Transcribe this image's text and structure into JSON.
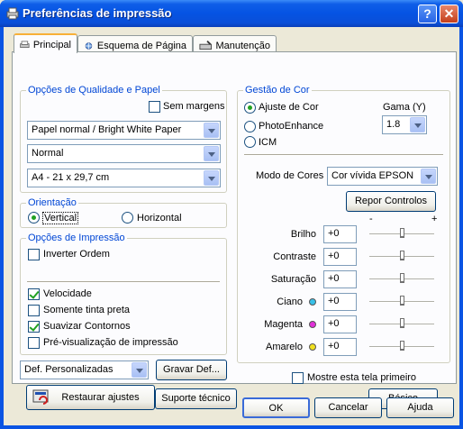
{
  "window": {
    "title": "Preferências de impressão",
    "help_glyph": "?",
    "close_glyph": "✕"
  },
  "tabs": [
    {
      "label": "Principal",
      "icon": "printer-icon"
    },
    {
      "label": "Esquema de Página",
      "icon": "layout-icon"
    },
    {
      "label": "Manutenção",
      "icon": "tools-icon"
    }
  ],
  "quality": {
    "legend": "Opções de Qualidade e Papel",
    "borderless_label": "Sem margens",
    "borderless_checked": false,
    "paper_type": "Papel normal / Bright White Paper",
    "quality": "Normal",
    "paper_size": "A4 - 21 x 29,7 cm"
  },
  "orientation": {
    "legend": "Orientação",
    "portrait_label": "Vertical",
    "landscape_label": "Horizontal",
    "selected": "Vertical"
  },
  "print_options": {
    "legend": "Opções de Impressão",
    "reverse_order_label": "Inverter Ordem",
    "reverse_order_checked": false,
    "high_speed_label": "Velocidade",
    "high_speed_checked": true,
    "black_ink_label": "Somente tinta preta",
    "black_ink_checked": false,
    "edge_smoothing_label": "Suavizar Contornos",
    "edge_smoothing_checked": true,
    "print_preview_label": "Pré-visualização de impressão",
    "print_preview_checked": false
  },
  "custom": {
    "selected": "Def. Personalizadas",
    "save_label": "Gravar Def...",
    "restore_label": "Restaurar ajustes",
    "support_label": "Suporte técnico"
  },
  "color": {
    "legend": "Gestão de Cor",
    "color_controls_label": "Ajuste de Cor",
    "photoenhance_label": "PhotoEnhance",
    "icm_label": "ICM",
    "selected": "Ajuste de Cor",
    "gamma_label": "Gama (Y)",
    "gamma_value": "1.8",
    "mode_label": "Modo de Cores",
    "mode_value": "Cor vívida EPSON",
    "reset_label": "Repor Controlos",
    "minus": "-",
    "plus": "+",
    "sliders": [
      {
        "label": "Brilho",
        "value": "+0",
        "dot": ""
      },
      {
        "label": "Contraste",
        "value": "+0",
        "dot": ""
      },
      {
        "label": "Saturação",
        "value": "+0",
        "dot": ""
      },
      {
        "label": "Ciano",
        "value": "+0",
        "dot": "#38c0e8"
      },
      {
        "label": "Magenta",
        "value": "+0",
        "dot": "#e030d8"
      },
      {
        "label": "Amarelo",
        "value": "+0",
        "dot": "#f0e020"
      }
    ],
    "show_first_label": "Mostre esta tela primeiro",
    "show_first_checked": false,
    "basic_label": "Básico"
  },
  "footer": {
    "ok_label": "OK",
    "cancel_label": "Cancelar",
    "help_label": "Ajuda"
  }
}
